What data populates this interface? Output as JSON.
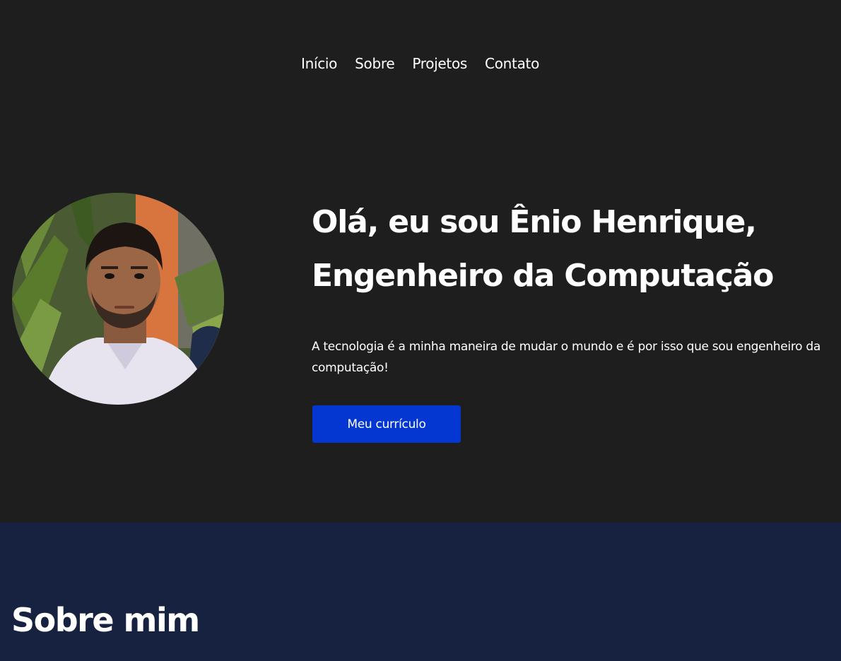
{
  "nav": {
    "items": [
      {
        "label": "Início"
      },
      {
        "label": "Sobre"
      },
      {
        "label": "Projetos"
      },
      {
        "label": "Contato"
      }
    ]
  },
  "hero": {
    "title_line1": "Olá, eu sou Ênio Henrique,",
    "title_line2": "Engenheiro da Computação",
    "description": "A tecnologia é a minha maneira de mudar o mundo e é por isso que sou engenheiro da computação!",
    "button_label": "Meu currículo",
    "photo_icon": "profile-photo"
  },
  "about": {
    "title": "Sobre mim"
  },
  "colors": {
    "page_background": "#1e1e1f",
    "about_background": "#172241",
    "button_background": "#0436d1",
    "text": "#ffffff"
  }
}
